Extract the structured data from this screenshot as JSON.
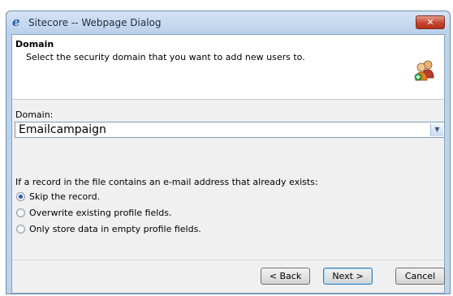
{
  "window": {
    "title": "Sitecore -- Webpage Dialog",
    "close_label": "✕"
  },
  "header": {
    "title": "Domain",
    "subtitle": "Select the security domain that you want to add new users to."
  },
  "form": {
    "domain_label": "Domain:",
    "domain_value": "Emailcampaign",
    "existing_question": "If a record in the file contains an e-mail address that already exists:",
    "options": [
      {
        "label": "Skip the record.",
        "checked": true
      },
      {
        "label": "Overwrite existing profile fields.",
        "checked": false
      },
      {
        "label": "Only store data in empty profile fields.",
        "checked": false
      }
    ]
  },
  "footer": {
    "back_label": "< Back",
    "next_label": "Next >",
    "cancel_label": "Cancel"
  },
  "icons": {
    "browser": "ie-icon",
    "header": "users-icon",
    "dropdown": "chevron-down-icon"
  }
}
